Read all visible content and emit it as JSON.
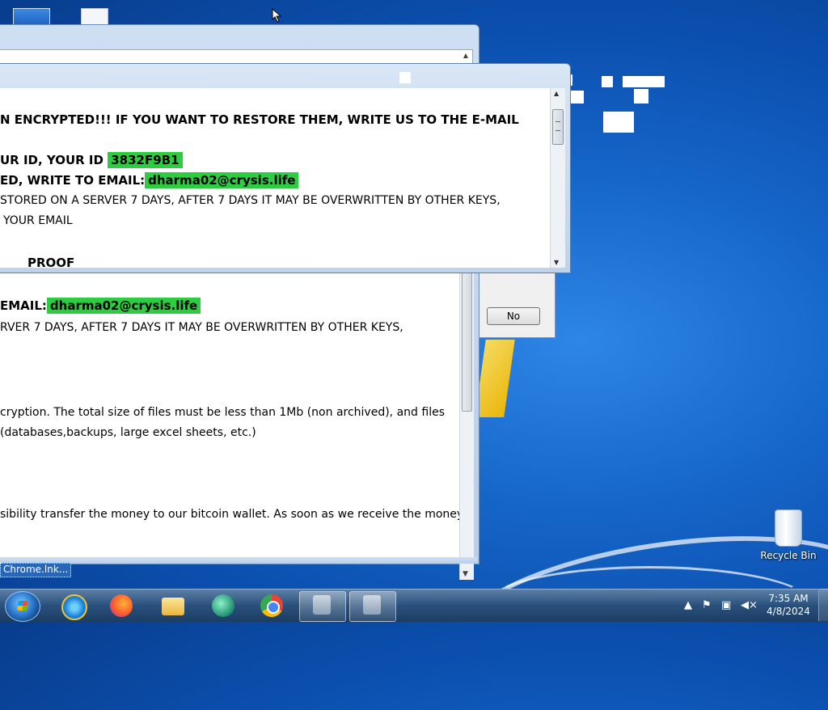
{
  "note_back": {
    "line1_prefix": "EMAIL:",
    "line1_email": "dharma02@crysis.life",
    "line2": "RVER 7 DAYS, AFTER 7 DAYS IT MAY BE OVERWRITTEN BY OTHER KEYS,",
    "line3": "cryption. The total size of files must be less than 1Mb (non archived), and files",
    "line4": "(databases,backups, large excel sheets, etc.)",
    "line5": "sibility transfer the money to our bitcoin wallet. As soon as we receive the money we"
  },
  "note_front": {
    "line1": "N ENCRYPTED!!! IF YOU WANT TO RESTORE THEM, WRITE US TO THE E-MAIL",
    "line2_prefix": "UR ID, YOUR ID",
    "line2_id": "3832F9B1",
    "line3_prefix": "ED, WRITE TO EMAIL:",
    "line3_email": "dharma02@crysis.life",
    "line4": "STORED ON A SERVER 7 DAYS, AFTER 7 DAYS IT MAY BE OVERWRITTEN BY OTHER KEYS,",
    "line5": "YOUR EMAIL",
    "line6": "PROOF"
  },
  "dialog": {
    "no_label": "No"
  },
  "desktop": {
    "recycle_bin": "Recycle Bin",
    "chrome_lnk": "Chrome.lnk..."
  },
  "taskbar": {
    "time": "7:35 AM",
    "date": "4/8/2024"
  },
  "colors": {
    "highlight": "#2ecc40",
    "desktop": "#1565c8"
  },
  "icons": {
    "start": "windows-orb-icon",
    "ie": "internet-explorer-icon",
    "firefox": "firefox-icon",
    "explorer": "folder-icon",
    "app": "globe-icon",
    "chrome": "chrome-icon"
  }
}
